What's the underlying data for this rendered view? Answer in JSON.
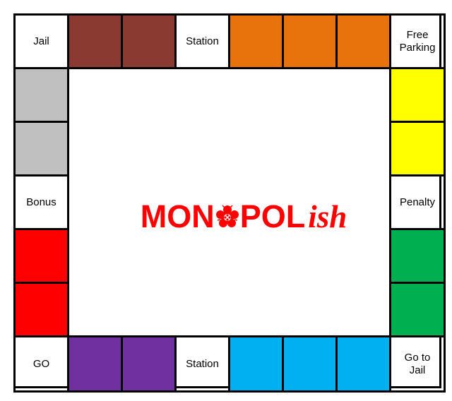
{
  "board": {
    "corners": {
      "top_left": "Jail",
      "top_right": [
        "Free",
        "Parking"
      ],
      "bottom_left": "GO",
      "bottom_right": [
        "Go to",
        "Jail"
      ]
    },
    "top": {
      "station": "Station",
      "colors": {
        "brown": "#8b3a32",
        "orange": "#e8720c"
      }
    },
    "bottom": {
      "station": "Station",
      "colors": {
        "purple": "#7030a0",
        "blue": "#00b0f0"
      }
    },
    "left": {
      "bonus": "Bonus",
      "colors": {
        "grey": "#c0c0c0",
        "red": "#ff0000"
      }
    },
    "right": {
      "penalty": "Penalty",
      "colors": {
        "yellow": "#ffff00",
        "green": "#00b050"
      }
    }
  },
  "logo": {
    "part1": "MON",
    "part2": "POL",
    "part3": "ish",
    "color": "#ff0000",
    "emblem_icon": "tudor-rose-icon"
  }
}
